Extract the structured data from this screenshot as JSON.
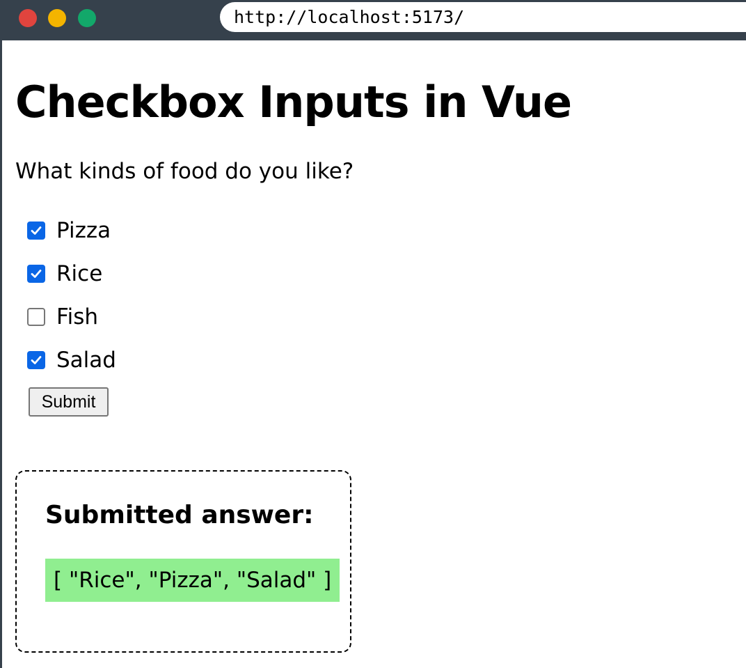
{
  "browser": {
    "url": "http://localhost:5173/"
  },
  "page": {
    "title": "Checkbox Inputs in Vue",
    "question": "What kinds of food do you like?",
    "options": [
      {
        "label": "Pizza",
        "checked": true
      },
      {
        "label": "Rice",
        "checked": true
      },
      {
        "label": "Fish",
        "checked": false
      },
      {
        "label": "Salad",
        "checked": true
      }
    ],
    "submit_label": "Submit",
    "result": {
      "heading": "Submitted answer:",
      "value": "[ \"Rice\", \"Pizza\", \"Salad\" ]"
    }
  },
  "colors": {
    "chrome": "#36414c",
    "close": "#e0443e",
    "minimize": "#f4b400",
    "maximize": "#12a86a",
    "checkbox_accent": "#0a66e6",
    "result_highlight": "#90ee90"
  }
}
